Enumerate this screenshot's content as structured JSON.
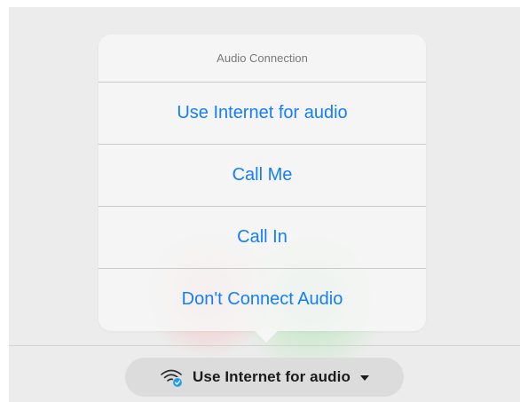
{
  "popover": {
    "title": "Audio Connection",
    "options": [
      {
        "label": "Use Internet for audio"
      },
      {
        "label": "Call Me"
      },
      {
        "label": "Call In"
      },
      {
        "label": "Don't Connect Audio"
      }
    ]
  },
  "toolbar": {
    "audio_button_label": "Use Internet for audio",
    "audio_icon": "wifi-audio-icon",
    "dropdown_icon": "caret-down-icon"
  },
  "colors": {
    "accent": "#147efb",
    "badge": "#1e9bf0"
  }
}
